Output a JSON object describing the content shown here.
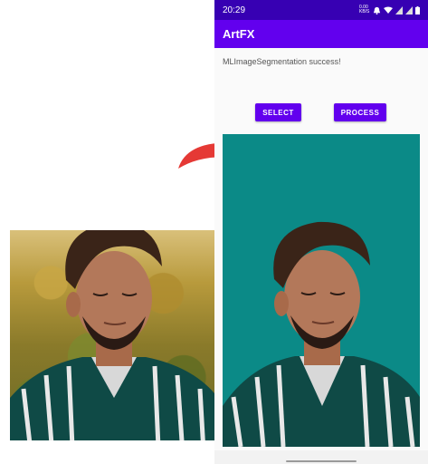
{
  "status_bar": {
    "time": "20:29",
    "data_speed": "0.00 KB/S",
    "icons": [
      "data-speed-icon",
      "bell-icon",
      "wifi-icon",
      "signal-icon",
      "signal-icon",
      "battery-icon"
    ]
  },
  "app_bar": {
    "title": "ArtFX"
  },
  "status_message": "MLImageSegmentation success!",
  "buttons": {
    "select_label": "SELECT",
    "process_label": "PROCESS"
  },
  "colors": {
    "primary": "#6200ee",
    "primary_dark": "#3700b3",
    "result_background": "#0b8a87",
    "arrow": "#e53935"
  },
  "images": {
    "original": "portrait-photo-with-foliage-background",
    "result": "portrait-photo-with-teal-background"
  }
}
